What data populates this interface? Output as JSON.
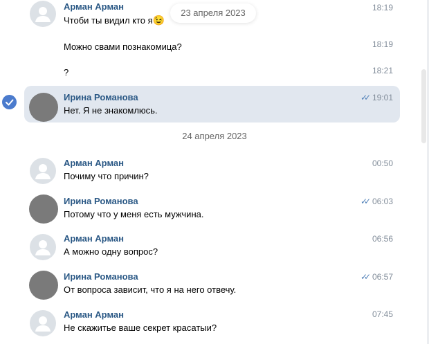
{
  "messages": [
    {
      "author": "Арман Арман",
      "time": "18:19",
      "text": "Чтоби ты видил кто я",
      "emoji": "😉"
    },
    {
      "text": "Можно свами познакомица?",
      "time": "18:19"
    },
    {
      "text": "?",
      "time": "18:21"
    },
    {
      "author": "Ирина Романова",
      "time": "19:01",
      "text": "Нет. Я не знакомлюсь.",
      "read": true
    },
    {
      "author": "Арман Арман",
      "time": "00:50",
      "text": "Почиму что причин?"
    },
    {
      "author": "Ирина Романова",
      "time": "06:03",
      "text": "Потому что у меня есть мужчина.",
      "read": true
    },
    {
      "author": "Арман Арман",
      "time": "06:56",
      "text": "А можно одну вопрос?"
    },
    {
      "author": "Ирина Романова",
      "time": "06:57",
      "text": "От вопроса зависит, что я на него отвечу.",
      "read": true
    },
    {
      "author": "Арман Арман",
      "time": "07:45",
      "text": "Не скажитье ваше секрет красатыи?"
    }
  ],
  "dates": {
    "floating": "23 апреля 2023",
    "separator": "24 апреля 2023"
  },
  "icons": {
    "read": "double-check-icon",
    "selected": "checkmark-icon",
    "avatar_placeholder": "user-silhouette-icon"
  },
  "colors": {
    "accent": "#2a5885",
    "selected_bg": "#e1e7ef",
    "check": "#4b7bcd"
  }
}
